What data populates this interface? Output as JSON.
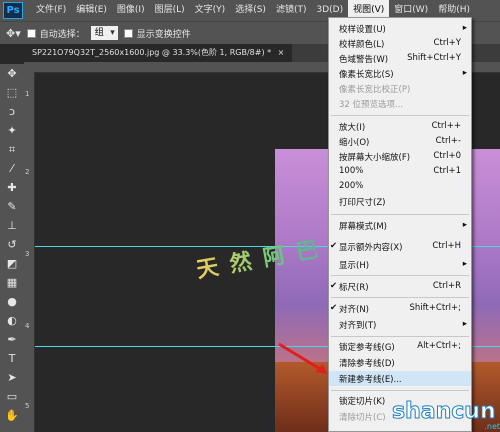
{
  "app": {
    "logo": "Ps"
  },
  "menubar": {
    "items": [
      "文件(F)",
      "编辑(E)",
      "图像(I)",
      "图层(L)",
      "文字(Y)",
      "选择(S)",
      "滤镜(T)",
      "3D(D)",
      "视图(V)",
      "窗口(W)",
      "帮助(H)"
    ],
    "active": "视图(V)"
  },
  "options": {
    "auto_select_label": "自动选择：",
    "auto_select_value": "组",
    "show_transform_label": "显示变换控件"
  },
  "document": {
    "tab_title": "SP221O79Q32T_2560x1600.jpg @ 33.3%(色阶 1, RGB/8#) *",
    "close": "×"
  },
  "ruler_left_marks": [
    "1",
    "2",
    "3",
    "4",
    "5"
  ],
  "watermark_text": "天 然 阿 巴 你 姐",
  "view_menu": {
    "items": [
      {
        "label": "校样设置(U)",
        "shortcut": "",
        "submenu": true
      },
      {
        "label": "校样颜色(L)",
        "shortcut": "Ctrl+Y"
      },
      {
        "label": "色域警告(W)",
        "shortcut": "Shift+Ctrl+Y"
      },
      {
        "label": "像素长宽比(S)",
        "shortcut": "",
        "submenu": true
      },
      {
        "label": "像素长宽比校正(P)",
        "shortcut": "",
        "disabled": true
      },
      {
        "label": "32 位预览选项...",
        "shortcut": "",
        "disabled": true
      },
      {
        "label": "放大(I)",
        "shortcut": "Ctrl++"
      },
      {
        "label": "缩小(O)",
        "shortcut": "Ctrl+-"
      },
      {
        "label": "按屏幕大小缩放(F)",
        "shortcut": "Ctrl+0"
      },
      {
        "label": "100%",
        "shortcut": "Ctrl+1"
      },
      {
        "label": "200%",
        "shortcut": ""
      },
      {
        "label": "打印尺寸(Z)",
        "shortcut": ""
      },
      {
        "label": "屏幕模式(M)",
        "shortcut": "",
        "submenu": true
      },
      {
        "label": "显示额外内容(X)",
        "shortcut": "Ctrl+H",
        "checked": true
      },
      {
        "label": "显示(H)",
        "shortcut": "",
        "submenu": true
      },
      {
        "label": "标尺(R)",
        "shortcut": "Ctrl+R",
        "checked": true
      },
      {
        "label": "对齐(N)",
        "shortcut": "Shift+Ctrl+;",
        "checked": true
      },
      {
        "label": "对齐到(T)",
        "shortcut": "",
        "submenu": true
      },
      {
        "label": "锁定参考线(G)",
        "shortcut": "Alt+Ctrl+;"
      },
      {
        "label": "清除参考线(D)",
        "shortcut": ""
      },
      {
        "label": "新建参考线(E)...",
        "shortcut": ""
      },
      {
        "label": "锁定切片(K)",
        "shortcut": ""
      },
      {
        "label": "清除切片(C)",
        "shortcut": "",
        "disabled": true
      }
    ]
  },
  "site_logo": {
    "text": "shancun",
    "suffix": ".net"
  },
  "colors": {
    "accent": "#31a8ff",
    "guide": "#4fd6e6",
    "arrow": "#e0201a"
  }
}
